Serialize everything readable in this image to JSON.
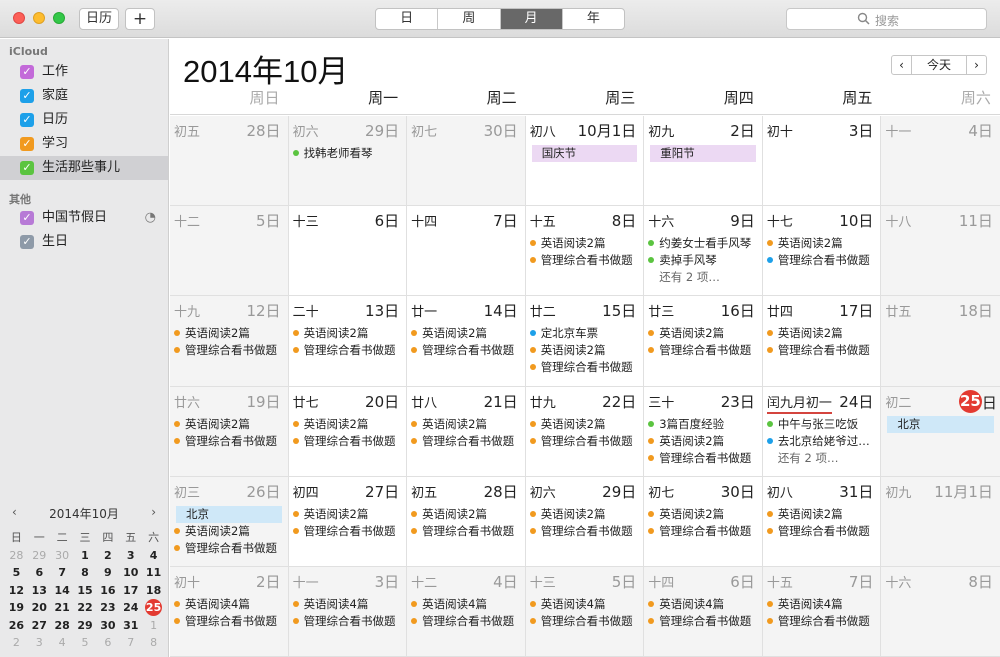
{
  "toolbar": {
    "calendars_label": "日历",
    "add_label": "+",
    "views": [
      {
        "label": "日",
        "active": false
      },
      {
        "label": "周",
        "active": false
      },
      {
        "label": "月",
        "active": true
      },
      {
        "label": "年",
        "active": false
      }
    ],
    "search_placeholder": "搜索"
  },
  "sidebar": {
    "group_icloud": "iCloud",
    "icloud_items": [
      {
        "label": "工作",
        "color": "#c36ad9",
        "checked": true
      },
      {
        "label": "家庭",
        "color": "#1da0e9",
        "checked": true
      },
      {
        "label": "日历",
        "color": "#1da0e9",
        "checked": true
      },
      {
        "label": "学习",
        "color": "#f19a1f",
        "checked": true
      },
      {
        "label": "生活那些事儿",
        "color": "#5bc440",
        "checked": true,
        "selected": true
      }
    ],
    "group_other": "其他",
    "other_items": [
      {
        "label": "中国节假日",
        "color": "#b77ad6",
        "checked": true,
        "subscribed": true
      },
      {
        "label": "生日",
        "color": "#8e9aa8",
        "checked": true
      }
    ]
  },
  "mini_calendar": {
    "title": "2014年10月",
    "prev": "‹",
    "next": "›",
    "weekdays": [
      "日",
      "一",
      "二",
      "三",
      "四",
      "五",
      "六"
    ],
    "weeks": [
      [
        {
          "d": "28",
          "dim": true
        },
        {
          "d": "29",
          "dim": true
        },
        {
          "d": "30",
          "dim": true
        },
        {
          "d": "1"
        },
        {
          "d": "2"
        },
        {
          "d": "3"
        },
        {
          "d": "4"
        }
      ],
      [
        {
          "d": "5"
        },
        {
          "d": "6"
        },
        {
          "d": "7"
        },
        {
          "d": "8"
        },
        {
          "d": "9"
        },
        {
          "d": "10"
        },
        {
          "d": "11"
        }
      ],
      [
        {
          "d": "12"
        },
        {
          "d": "13"
        },
        {
          "d": "14"
        },
        {
          "d": "15"
        },
        {
          "d": "16"
        },
        {
          "d": "17"
        },
        {
          "d": "18"
        }
      ],
      [
        {
          "d": "19"
        },
        {
          "d": "20"
        },
        {
          "d": "21"
        },
        {
          "d": "22"
        },
        {
          "d": "23"
        },
        {
          "d": "24"
        },
        {
          "d": "25",
          "today": true
        }
      ],
      [
        {
          "d": "26"
        },
        {
          "d": "27"
        },
        {
          "d": "28"
        },
        {
          "d": "29"
        },
        {
          "d": "30"
        },
        {
          "d": "31"
        },
        {
          "d": "1",
          "dim": true
        }
      ],
      [
        {
          "d": "2",
          "dim": true
        },
        {
          "d": "3",
          "dim": true
        },
        {
          "d": "4",
          "dim": true
        },
        {
          "d": "5",
          "dim": true
        },
        {
          "d": "6",
          "dim": true
        },
        {
          "d": "7",
          "dim": true
        },
        {
          "d": "8",
          "dim": true
        }
      ]
    ]
  },
  "main": {
    "month_title": "2014年10月",
    "nav_prev": "‹",
    "nav_today": "今天",
    "nav_next": "›",
    "weekdays": [
      "周日",
      "周一",
      "周二",
      "周三",
      "周四",
      "周五",
      "周六"
    ],
    "colors": {
      "orange": "#f19a1f",
      "green": "#5bc440",
      "blue": "#1da0e9",
      "holiday_bg": "#ecd9f3",
      "beijing_bg": "#cfe8f8"
    },
    "weeks": [
      [
        {
          "lunar": "初五",
          "num": "28日",
          "dim": true,
          "events": []
        },
        {
          "lunar": "初六",
          "num": "29日",
          "dim": true,
          "events": [
            {
              "text": "找韩老师看琴",
              "color": "green"
            }
          ]
        },
        {
          "lunar": "初七",
          "num": "30日",
          "dim": true,
          "events": []
        },
        {
          "lunar": "初八",
          "num": "10月1日",
          "allday": [
            {
              "text": "国庆节",
              "bg": "holiday_bg"
            }
          ],
          "events": []
        },
        {
          "lunar": "初九",
          "num": "2日",
          "allday": [
            {
              "text": "重阳节",
              "bg": "holiday_bg"
            }
          ],
          "events": []
        },
        {
          "lunar": "初十",
          "num": "3日",
          "events": []
        },
        {
          "lunar": "十一",
          "num": "4日",
          "events": []
        }
      ],
      [
        {
          "lunar": "十二",
          "num": "5日",
          "events": []
        },
        {
          "lunar": "十三",
          "num": "6日",
          "events": []
        },
        {
          "lunar": "十四",
          "num": "7日",
          "events": []
        },
        {
          "lunar": "十五",
          "num": "8日",
          "events": [
            {
              "text": "英语阅读2篇",
              "color": "orange"
            },
            {
              "text": "管理综合看书做题",
              "color": "orange"
            }
          ]
        },
        {
          "lunar": "十六",
          "num": "9日",
          "events": [
            {
              "text": "约姜女士看手风琴",
              "color": "green"
            },
            {
              "text": "卖掉手风琴",
              "color": "green"
            },
            {
              "text": "还有 2 项…",
              "more": true
            }
          ]
        },
        {
          "lunar": "十七",
          "num": "10日",
          "events": [
            {
              "text": "英语阅读2篇",
              "color": "orange"
            },
            {
              "text": "管理综合看书做题",
              "color": "blue"
            }
          ]
        },
        {
          "lunar": "十八",
          "num": "11日",
          "events": []
        }
      ],
      [
        {
          "lunar": "十九",
          "num": "12日",
          "events": [
            {
              "text": "英语阅读2篇",
              "color": "orange"
            },
            {
              "text": "管理综合看书做题",
              "color": "orange"
            }
          ]
        },
        {
          "lunar": "二十",
          "num": "13日",
          "events": [
            {
              "text": "英语阅读2篇",
              "color": "orange"
            },
            {
              "text": "管理综合看书做题",
              "color": "orange"
            }
          ]
        },
        {
          "lunar": "廿一",
          "num": "14日",
          "events": [
            {
              "text": "英语阅读2篇",
              "color": "orange"
            },
            {
              "text": "管理综合看书做题",
              "color": "orange"
            }
          ]
        },
        {
          "lunar": "廿二",
          "num": "15日",
          "events": [
            {
              "text": "定北京车票",
              "color": "blue"
            },
            {
              "text": "英语阅读2篇",
              "color": "orange"
            },
            {
              "text": "管理综合看书做题",
              "color": "orange"
            }
          ]
        },
        {
          "lunar": "廿三",
          "num": "16日",
          "events": [
            {
              "text": "英语阅读2篇",
              "color": "orange"
            },
            {
              "text": "管理综合看书做题",
              "color": "orange"
            }
          ]
        },
        {
          "lunar": "廿四",
          "num": "17日",
          "events": [
            {
              "text": "英语阅读2篇",
              "color": "orange"
            },
            {
              "text": "管理综合看书做题",
              "color": "orange"
            }
          ]
        },
        {
          "lunar": "廿五",
          "num": "18日",
          "events": []
        }
      ],
      [
        {
          "lunar": "廿六",
          "num": "19日",
          "events": [
            {
              "text": "英语阅读2篇",
              "color": "orange"
            },
            {
              "text": "管理综合看书做题",
              "color": "orange"
            }
          ]
        },
        {
          "lunar": "廿七",
          "num": "20日",
          "events": [
            {
              "text": "英语阅读2篇",
              "color": "orange"
            },
            {
              "text": "管理综合看书做题",
              "color": "orange"
            }
          ]
        },
        {
          "lunar": "廿八",
          "num": "21日",
          "events": [
            {
              "text": "英语阅读2篇",
              "color": "orange"
            },
            {
              "text": "管理综合看书做题",
              "color": "orange"
            }
          ]
        },
        {
          "lunar": "廿九",
          "num": "22日",
          "events": [
            {
              "text": "英语阅读2篇",
              "color": "orange"
            },
            {
              "text": "管理综合看书做题",
              "color": "orange"
            }
          ]
        },
        {
          "lunar": "三十",
          "num": "23日",
          "events": [
            {
              "text": "3篇百度经验",
              "color": "green"
            },
            {
              "text": "英语阅读2篇",
              "color": "orange"
            },
            {
              "text": "管理综合看书做题",
              "color": "orange"
            }
          ]
        },
        {
          "lunar": "闰九月初一",
          "num": "24日",
          "redline": true,
          "events": [
            {
              "text": "中午与张三吃饭",
              "color": "green"
            },
            {
              "text": "去北京给姥爷过…",
              "color": "blue"
            },
            {
              "text": "还有 2 项…",
              "more": true
            }
          ]
        },
        {
          "lunar": "初二",
          "num": "25",
          "suffix": "日",
          "today": true,
          "allday": [
            {
              "text": "北京",
              "bg": "beijing_bg"
            }
          ],
          "events": []
        }
      ],
      [
        {
          "lunar": "初三",
          "num": "26日",
          "allday": [
            {
              "text": "北京",
              "bg": "beijing_bg"
            }
          ],
          "events": [
            {
              "text": "英语阅读2篇",
              "color": "orange"
            },
            {
              "text": "管理综合看书做题",
              "color": "orange"
            }
          ]
        },
        {
          "lunar": "初四",
          "num": "27日",
          "events": [
            {
              "text": "英语阅读2篇",
              "color": "orange"
            },
            {
              "text": "管理综合看书做题",
              "color": "orange"
            }
          ]
        },
        {
          "lunar": "初五",
          "num": "28日",
          "events": [
            {
              "text": "英语阅读2篇",
              "color": "orange"
            },
            {
              "text": "管理综合看书做题",
              "color": "orange"
            }
          ]
        },
        {
          "lunar": "初六",
          "num": "29日",
          "events": [
            {
              "text": "英语阅读2篇",
              "color": "orange"
            },
            {
              "text": "管理综合看书做题",
              "color": "orange"
            }
          ]
        },
        {
          "lunar": "初七",
          "num": "30日",
          "events": [
            {
              "text": "英语阅读2篇",
              "color": "orange"
            },
            {
              "text": "管理综合看书做题",
              "color": "orange"
            }
          ]
        },
        {
          "lunar": "初八",
          "num": "31日",
          "events": [
            {
              "text": "英语阅读2篇",
              "color": "orange"
            },
            {
              "text": "管理综合看书做题",
              "color": "orange"
            }
          ]
        },
        {
          "lunar": "初九",
          "num": "11月1日",
          "dim": true,
          "events": []
        }
      ],
      [
        {
          "lunar": "初十",
          "num": "2日",
          "dim": true,
          "events": [
            {
              "text": "英语阅读4篇",
              "color": "orange"
            },
            {
              "text": "管理综合看书做题",
              "color": "orange"
            }
          ]
        },
        {
          "lunar": "十一",
          "num": "3日",
          "dim": true,
          "events": [
            {
              "text": "英语阅读4篇",
              "color": "orange"
            },
            {
              "text": "管理综合看书做题",
              "color": "orange"
            }
          ]
        },
        {
          "lunar": "十二",
          "num": "4日",
          "dim": true,
          "events": [
            {
              "text": "英语阅读4篇",
              "color": "orange"
            },
            {
              "text": "管理综合看书做题",
              "color": "orange"
            }
          ]
        },
        {
          "lunar": "十三",
          "num": "5日",
          "dim": true,
          "events": [
            {
              "text": "英语阅读4篇",
              "color": "orange"
            },
            {
              "text": "管理综合看书做题",
              "color": "orange"
            }
          ]
        },
        {
          "lunar": "十四",
          "num": "6日",
          "dim": true,
          "events": [
            {
              "text": "英语阅读4篇",
              "color": "orange"
            },
            {
              "text": "管理综合看书做题",
              "color": "orange"
            }
          ]
        },
        {
          "lunar": "十五",
          "num": "7日",
          "dim": true,
          "events": [
            {
              "text": "英语阅读4篇",
              "color": "orange"
            },
            {
              "text": "管理综合看书做题",
              "color": "orange"
            }
          ]
        },
        {
          "lunar": "十六",
          "num": "8日",
          "dim": true,
          "events": []
        }
      ]
    ]
  }
}
